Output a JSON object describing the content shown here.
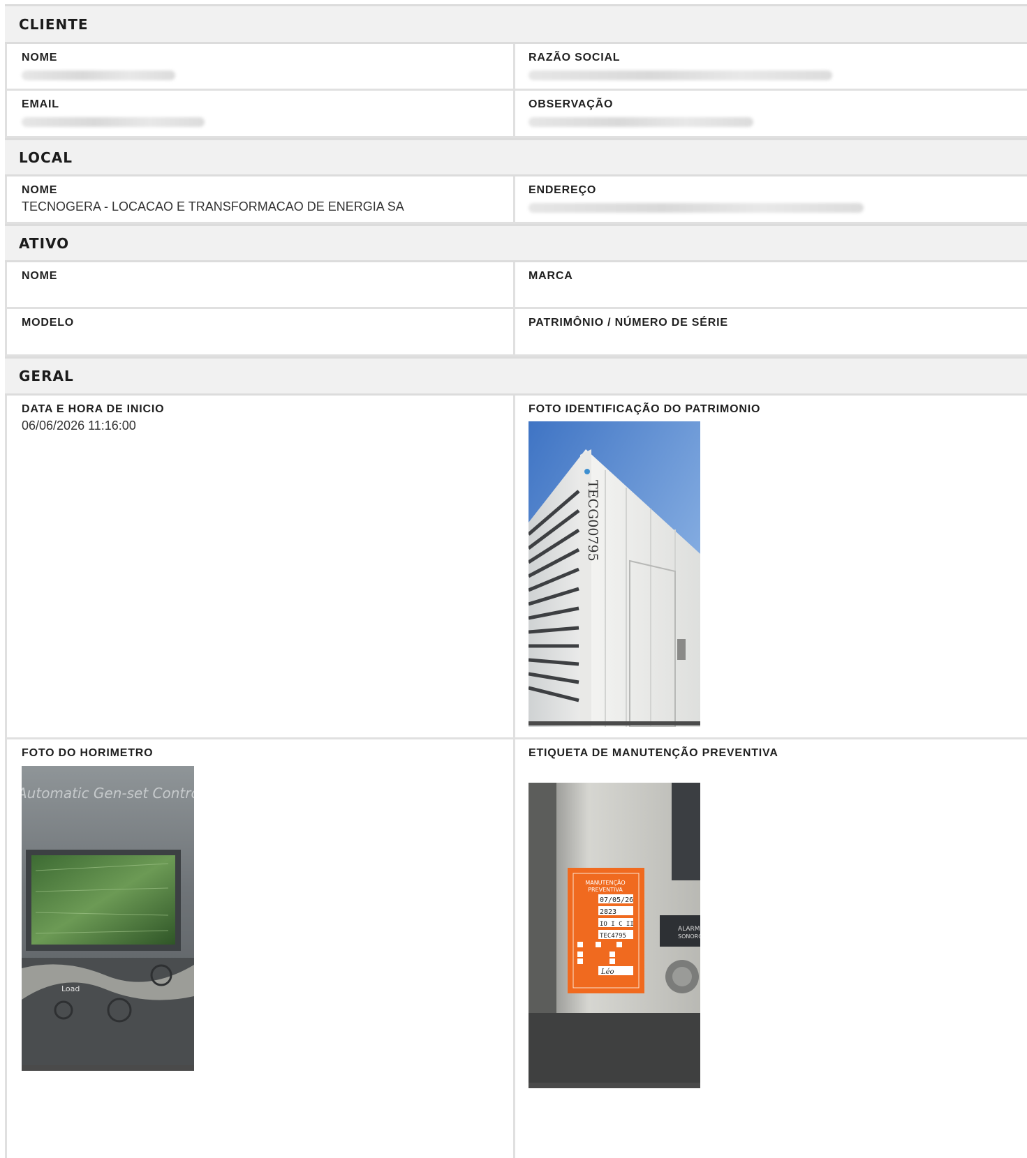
{
  "cliente": {
    "title": "CLIENTE",
    "nome_label": "NOME",
    "razao_label": "RAZÃO SOCIAL",
    "email_label": "EMAIL",
    "obs_label": "OBSERVAÇÃO"
  },
  "local": {
    "title": "LOCAL",
    "nome_label": "NOME",
    "nome_value": "TECNOGERA - LOCACAO E TRANSFORMACAO DE ENERGIA SA",
    "endereco_label": "ENDEREÇO"
  },
  "ativo": {
    "title": "ATIVO",
    "nome_label": "NOME",
    "marca_label": "MARCA",
    "modelo_label": "MODELO",
    "patrimonio_label": "PATRIMÔNIO / NÚMERO DE SÉRIE"
  },
  "geral": {
    "title": "GERAL",
    "inicio_label": "DATA E HORA DE INICIO",
    "inicio_value": "06/06/2026 11:16:00",
    "foto_patrimonio_label": "FOTO IDENTIFICAÇÃO DO PATRIMONIO",
    "foto_horimetro_label": "FOTO DO HORIMETRO",
    "etiqueta_label": "ETIQUETA DE MANUTENÇÃO PREVENTIVA"
  },
  "photos": {
    "container_id": "TECG00795",
    "controller_text": "Automatic Gen-set Controller",
    "controller_button": "Load",
    "label_title_1": "MANUTENÇÃO",
    "label_title_2": "PREVENTIVA",
    "label_date": "07/05/26",
    "label_hours": "2823",
    "label_plan": "IO I C II",
    "label_patrimonio": "TEC4795",
    "label_resp": "Léo",
    "alarm_text_1": "ALARME",
    "alarm_text_2": "SONORO"
  }
}
